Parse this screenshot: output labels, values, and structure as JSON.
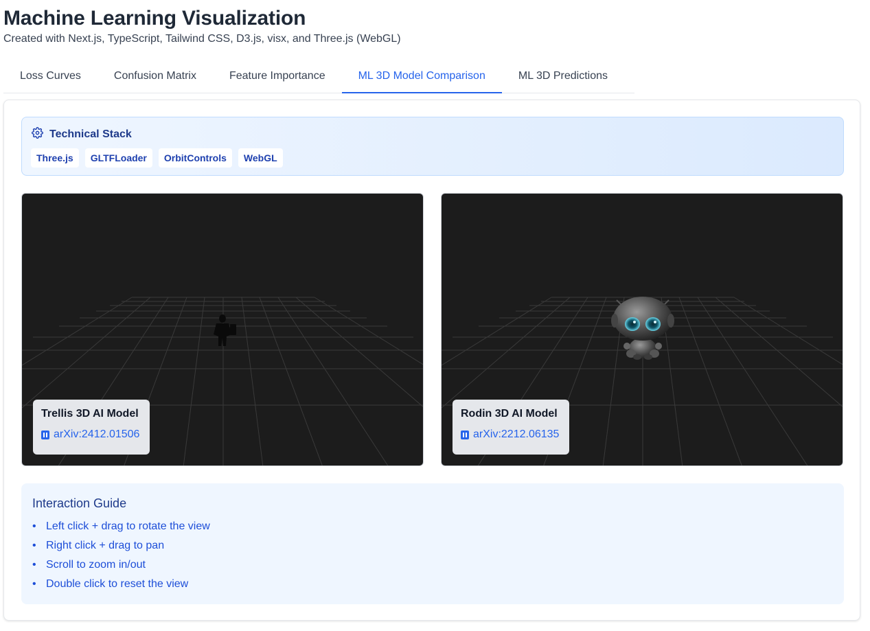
{
  "header": {
    "title": "Machine Learning Visualization",
    "subtitle": "Created with Next.js, TypeScript, Tailwind CSS, D3.js, visx, and Three.js (WebGL)"
  },
  "tabs": [
    {
      "label": "Loss Curves",
      "active": false
    },
    {
      "label": "Confusion Matrix",
      "active": false
    },
    {
      "label": "Feature Importance",
      "active": false
    },
    {
      "label": "ML 3D Model Comparison",
      "active": true
    },
    {
      "label": "ML 3D Predictions",
      "active": false
    }
  ],
  "tech_stack": {
    "title": "Technical Stack",
    "icon": "gear-icon",
    "chips": [
      "Three.js",
      "GLTFLoader",
      "OrbitControls",
      "WebGL"
    ]
  },
  "viewers": [
    {
      "model_name": "Trellis 3D AI Model",
      "link": "arXiv:2412.01506",
      "link_icon": "document-icon"
    },
    {
      "model_name": "Rodin 3D AI Model",
      "link": "arXiv:2212.06135",
      "link_icon": "document-icon"
    }
  ],
  "guide": {
    "title": "Interaction Guide",
    "items": [
      "Left click + drag to rotate the view",
      "Right click + drag to pan",
      "Scroll to zoom in/out",
      "Double click to reset the view"
    ]
  },
  "colors": {
    "accent": "#2563eb",
    "viewer_background": "#1c1c1c",
    "grid_line": "#3a3a3a",
    "stack_border": "#bfdbfe",
    "guide_background": "#eff6ff"
  }
}
